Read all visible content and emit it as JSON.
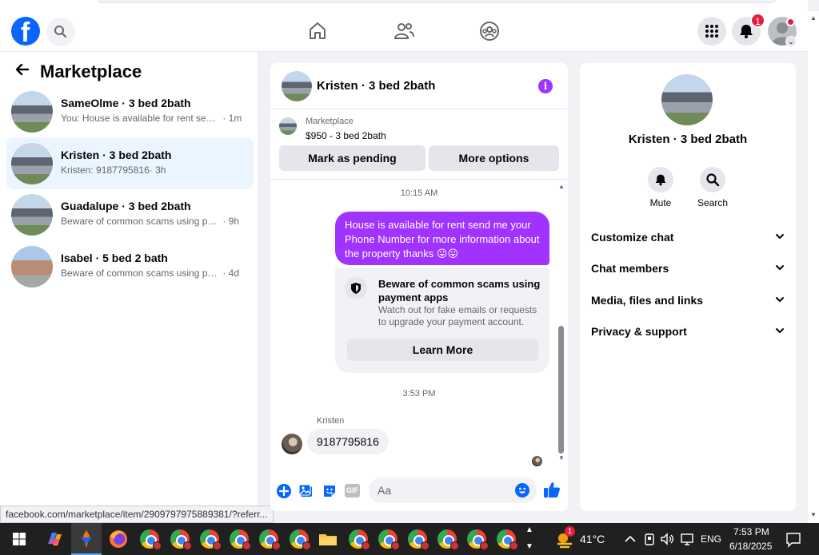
{
  "sidebar": {
    "title": "Marketplace",
    "conversations": [
      {
        "name": "SameOlme · 3 bed 2bath",
        "preview": "You: House is available for rent send me your Phone Number for more information about the property thanks",
        "time": "· 1m"
      },
      {
        "name": "Kristen · 3 bed 2bath",
        "preview": "Kristen: 9187795816",
        "time": "· 3h"
      },
      {
        "name": "Guadalupe · 3 bed 2bath",
        "preview": "Beware of common scams using payment apps",
        "time": "· 9h"
      },
      {
        "name": "Isabel · 5 bed 2 bath",
        "preview": "Beware of common scams using payment apps",
        "time": "· 4d"
      }
    ],
    "status_url": "facebook.com/marketplace/item/2909797975889381/?referr..."
  },
  "nav": {
    "notification_count": "1"
  },
  "chat": {
    "title": "Kristen · 3 bed 2bath",
    "listing_source": "Marketplace",
    "listing_price": "$950 - 3 bed 2bath",
    "mark_pending_label": "Mark as pending",
    "more_options_label": "More options",
    "time1": "10:15 AM",
    "outgoing_message": "House is available for rent send me your Phone Number for more information about the property thanks 😛😛",
    "scam_title": "Beware of common scams using payment apps",
    "scam_body": "Watch out for fake emails or requests to upgrade your payment account.",
    "learn_more_label": "Learn More",
    "time2": "3:53 PM",
    "sender_name": "Kristen",
    "incoming_message": "9187795816",
    "input_placeholder": "Aa"
  },
  "info": {
    "title": "Kristen · 3 bed 2bath",
    "mute_label": "Mute",
    "search_label": "Search",
    "sections": [
      "Customize chat",
      "Chat members",
      "Media, files and links",
      "Privacy & support"
    ]
  },
  "taskbar": {
    "weather": "41°C",
    "weather_badge": "1",
    "language": "ENG",
    "time": "7:53 PM",
    "date": "6/18/2025"
  },
  "colors": {
    "brand": "#0866ff",
    "accent": "#a033ff",
    "badge": "#e41e3f"
  }
}
